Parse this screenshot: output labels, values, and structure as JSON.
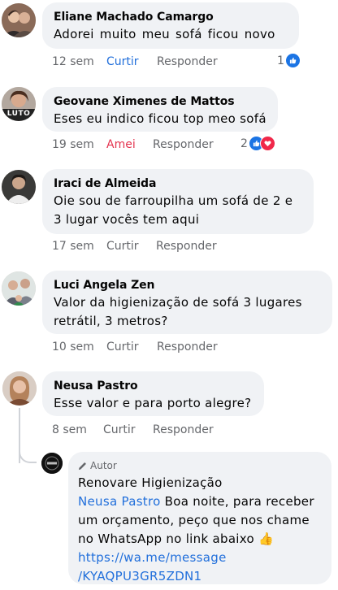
{
  "comments": [
    {
      "name": "Eliane Machado Camargo",
      "text": "Adorei  muito   meu sofá  ficou  novo",
      "time": "12 sem",
      "like": "Curtir",
      "reply": "Responder",
      "reaction_count": "1",
      "like_state": "liked"
    },
    {
      "name": "Geovane Ximenes de Mattos",
      "text": "Eses eu indico ficou top meo sofá",
      "time": "19 sem",
      "like": "Amei",
      "reply": "Responder",
      "reaction_count": "2",
      "avatar_badge": "LUTO",
      "like_state": "loved"
    },
    {
      "name": "Iraci de Almeida",
      "text": "Oie sou de farroupilha um sofá de 2 e 3 lugar vocês tem aqui",
      "time": "17 sem",
      "like": "Curtir",
      "reply": "Responder"
    },
    {
      "name": "Luci Angela Zen",
      "text": "Valor da higienização de sofá 3 lugares retrátil, 3 metros?",
      "time": "10 sem",
      "like": "Curtir",
      "reply": "Responder"
    },
    {
      "name": "Neusa Pastro",
      "text": "Esse valor e para porto alegre?",
      "time": "8 sem",
      "like": "Curtir",
      "reply": "Responder"
    }
  ],
  "reply": {
    "author_badge": "Autor",
    "name": "Renovare Higienização",
    "mention": "Neusa Pastro",
    "text": " Boa noite, para receber um orçamento, peço que nos chame no WhatsApp no link abaixo 👍",
    "link": "https://wa.me/message/KYAQPU3GR5ZDN1",
    "link_line1": "https://wa.me/message",
    "link_line2": "/KYAQPU3GR5ZDN1"
  },
  "colors": {
    "bubble": "#f0f2f5",
    "link": "#216fdb",
    "love": "#e4344f",
    "meta": "#65676b"
  }
}
